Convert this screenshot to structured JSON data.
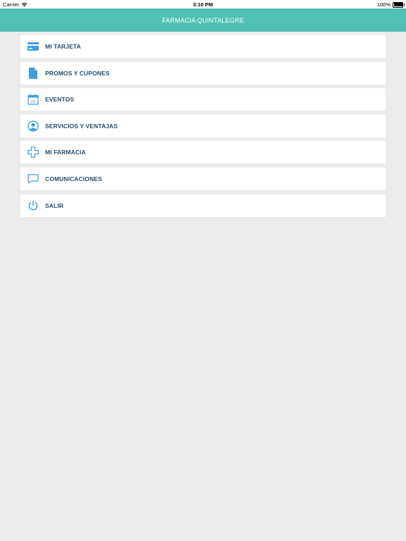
{
  "status_bar": {
    "carrier": "Carrier",
    "time": "3:10 PM",
    "battery": "100%"
  },
  "header": {
    "title": "FARMACIA QUINTALEGRE"
  },
  "menu": {
    "items": [
      {
        "label": "MI TARJETA",
        "icon": "card-icon"
      },
      {
        "label": "PROMOS Y CUPONES",
        "icon": "document-icon"
      },
      {
        "label": "EVENTOS",
        "icon": "calendar-icon",
        "icon_text": "25"
      },
      {
        "label": "SERVICIOS Y VENTAJAS",
        "icon": "user-icon"
      },
      {
        "label": "MI FARMACIA",
        "icon": "cross-icon"
      },
      {
        "label": "COMUNICACIONES",
        "icon": "chat-icon"
      },
      {
        "label": "SALIR",
        "icon": "power-icon"
      }
    ]
  },
  "colors": {
    "accent": "#50c2b5",
    "icon": "#3ba0e0",
    "label": "#2a4d6b",
    "background": "#ececec"
  }
}
